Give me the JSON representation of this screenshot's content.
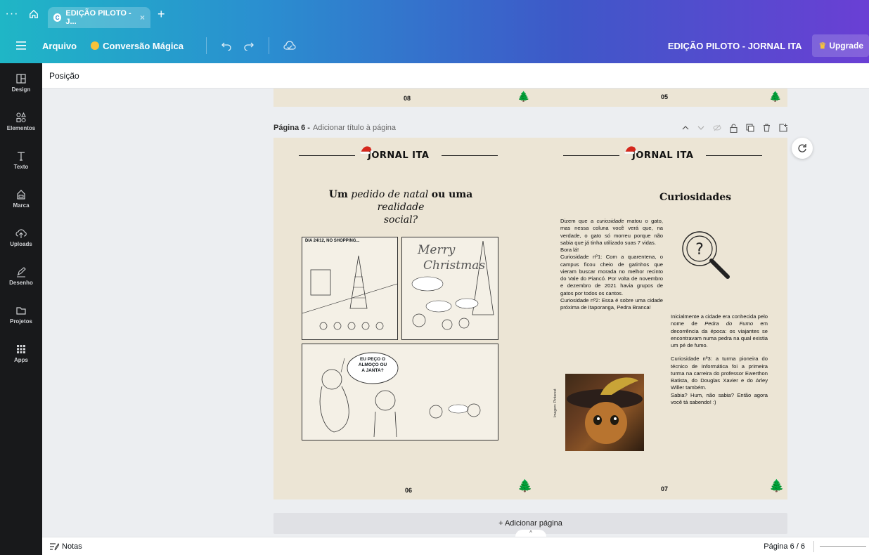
{
  "browser": {
    "tab_label": "EDIÇÃO PILOTO - J...",
    "tab_close": "×",
    "tab_add": "+"
  },
  "toolbar": {
    "file_menu": "Arquivo",
    "magic": "Conversão Mágica",
    "doc_title": "EDIÇÃO PILOTO - JORNAL ITA",
    "upgrade": "Upgrade"
  },
  "rail": {
    "items": [
      {
        "label": "Design",
        "icon": "layout-icon"
      },
      {
        "label": "Elementos",
        "icon": "shapes-icon"
      },
      {
        "label": "Texto",
        "icon": "text-icon"
      },
      {
        "label": "Marca",
        "icon": "brand-icon"
      },
      {
        "label": "Uploads",
        "icon": "upload-icon"
      },
      {
        "label": "Desenho",
        "icon": "draw-icon"
      },
      {
        "label": "Projetos",
        "icon": "folder-icon"
      },
      {
        "label": "Apps",
        "icon": "apps-icon"
      }
    ]
  },
  "secondary_bar": {
    "label": "Posição"
  },
  "prev_page": {
    "left_num": "08",
    "right_num": "05"
  },
  "page_header": {
    "title": "Página 6 -",
    "add_title": "Adicionar título à página"
  },
  "page": {
    "masthead": "JORNAL ITA",
    "left": {
      "title_1": "Um",
      "title_2": "pedido de natal",
      "title_3": "ou uma",
      "title_4": "realidade",
      "title_5": "social?",
      "comic_caption": "DIA 24/12, NO SHOPPING...",
      "comic_merry": "Merry",
      "comic_christmas": "Christmas",
      "comic_bubble_1": "EU PEÇO O",
      "comic_bubble_2": "ALMOÇO OU",
      "comic_bubble_3": "A JANTA?",
      "page_num": "06"
    },
    "right": {
      "title": "Curiosidades",
      "p1a": "Dizem que a",
      "p1b": "curiosidade",
      "p1c": "matou o gato, mas nessa coluna você verá que, na verdade, o gato só morreu porque não sabia que já tinha utilizado suas 7 vidas.",
      "p2": "Bora lá!",
      "p3": "Curiosidade nº1: Com a quarentena, o campus ficou cheio de gatinhos que vieram buscar morada no melhor recinto do Vale do Piancó. Por volta de novembro e dezembro de 2021 havia grupos de gatos por todos os cantos.",
      "p4": "Curiosidade nº2: Essa é sobre uma cidade próxima de Itaporanga, Pedra Branca!",
      "p5a": "Inicialmente a cidade era conhecida pelo nome de",
      "p5b": "Pedra do Fumo",
      "p5c": "em decorrência da época: os viajantes se encontravam numa pedra na qual existia um pé de fumo.",
      "p6": "Curiosidade nº3: a turma pioneira do técnico de Informática foi a primeira turma na carreira do professor Ewerthon Batista, do Douglas Xavier e do Arley Willer também.",
      "p7": "Sabia? Hum, não sabia? Então agora você tá sabendo! :)",
      "image_credit": "Imagem: Pinterest",
      "page_num": "07"
    }
  },
  "add_page": "+ Adicionar página",
  "collapse": "^",
  "bottom": {
    "notes": "Notas",
    "page_indicator": "Página 6 / 6"
  }
}
